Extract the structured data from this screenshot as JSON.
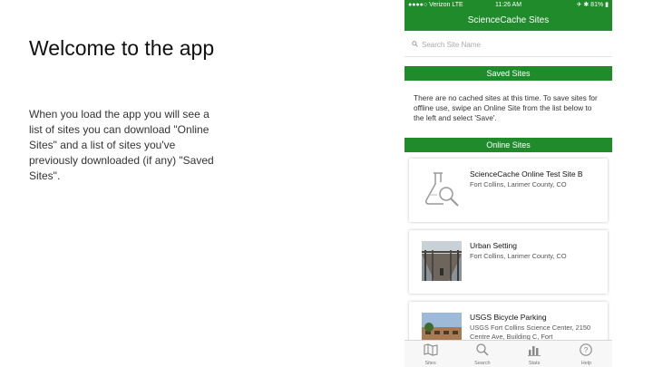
{
  "slide": {
    "title": "Welcome to the app",
    "body": "When you load the app you will see a list of sites you can download \"Online Sites\" and a list of sites you've previously downloaded (if any) \"Saved Sites\"."
  },
  "phone": {
    "status_bar": {
      "carrier": "●●●●○ Verizon  LTE",
      "time": "11:26 AM",
      "battery": "✈ ✱ 81% ▮"
    },
    "nav_title": "ScienceCache Sites",
    "search": {
      "placeholder": "Search Site Name",
      "value": ""
    },
    "saved_header": "Saved Sites",
    "saved_empty_message": "There are no cached sites at this time. To save sites for offline use, swipe an Online Site from the list below to the left and select 'Save'.",
    "online_header": "Online Sites",
    "sites": [
      {
        "title": "ScienceCache Online Test Site B",
        "subtitle": "Fort Collins, Larimer County, CO",
        "icon": "flask-magnifier-icon"
      },
      {
        "title": "Urban Setting",
        "subtitle": "Fort Collins, Larimer County, CO",
        "icon": "bridge-photo"
      },
      {
        "title": "USGS Bicycle Parking",
        "subtitle": "USGS Fort Collins Science Center, 2150 Centre Ave, Building C, Fort",
        "icon": "building-photo"
      }
    ],
    "tabs": [
      {
        "label": "Sites",
        "icon": "map-icon"
      },
      {
        "label": "Search",
        "icon": "search-icon"
      },
      {
        "label": "Stats",
        "icon": "bar-chart-icon"
      },
      {
        "label": "Help",
        "icon": "help-icon"
      }
    ],
    "colors": {
      "accent": "#1f8b2b"
    }
  }
}
